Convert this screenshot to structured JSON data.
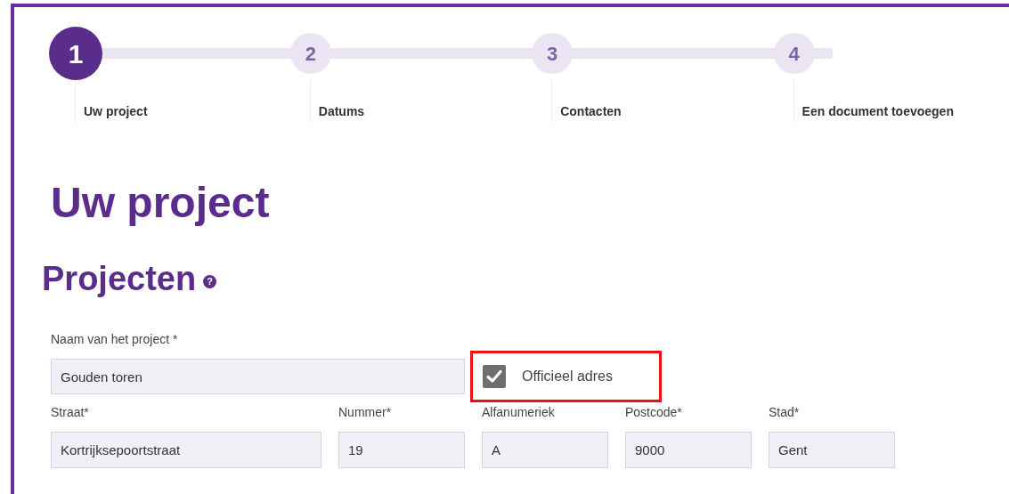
{
  "steps": [
    {
      "number": "1",
      "label": "Uw project",
      "selected": true
    },
    {
      "number": "2",
      "label": "Datums",
      "selected": false
    },
    {
      "number": "3",
      "label": "Contacten",
      "selected": false
    },
    {
      "number": "4",
      "label": "Een document toevoegen",
      "selected": false
    }
  ],
  "title": "Uw project",
  "section": {
    "title": "Projecten",
    "help": "?"
  },
  "project_name": {
    "label": "Naam van het project *",
    "value": "Gouden toren"
  },
  "official_address": {
    "label": "Officieel adres",
    "checked": true
  },
  "address_fields": [
    {
      "label": "Straat*",
      "value": "Kortrijksepoortstraat"
    },
    {
      "label": "Nummer*",
      "value": "19"
    },
    {
      "label": "Alfanumeriek",
      "value": "A"
    },
    {
      "label": "Postcode*",
      "value": "9000"
    },
    {
      "label": "Stad*",
      "value": "Gent"
    }
  ]
}
